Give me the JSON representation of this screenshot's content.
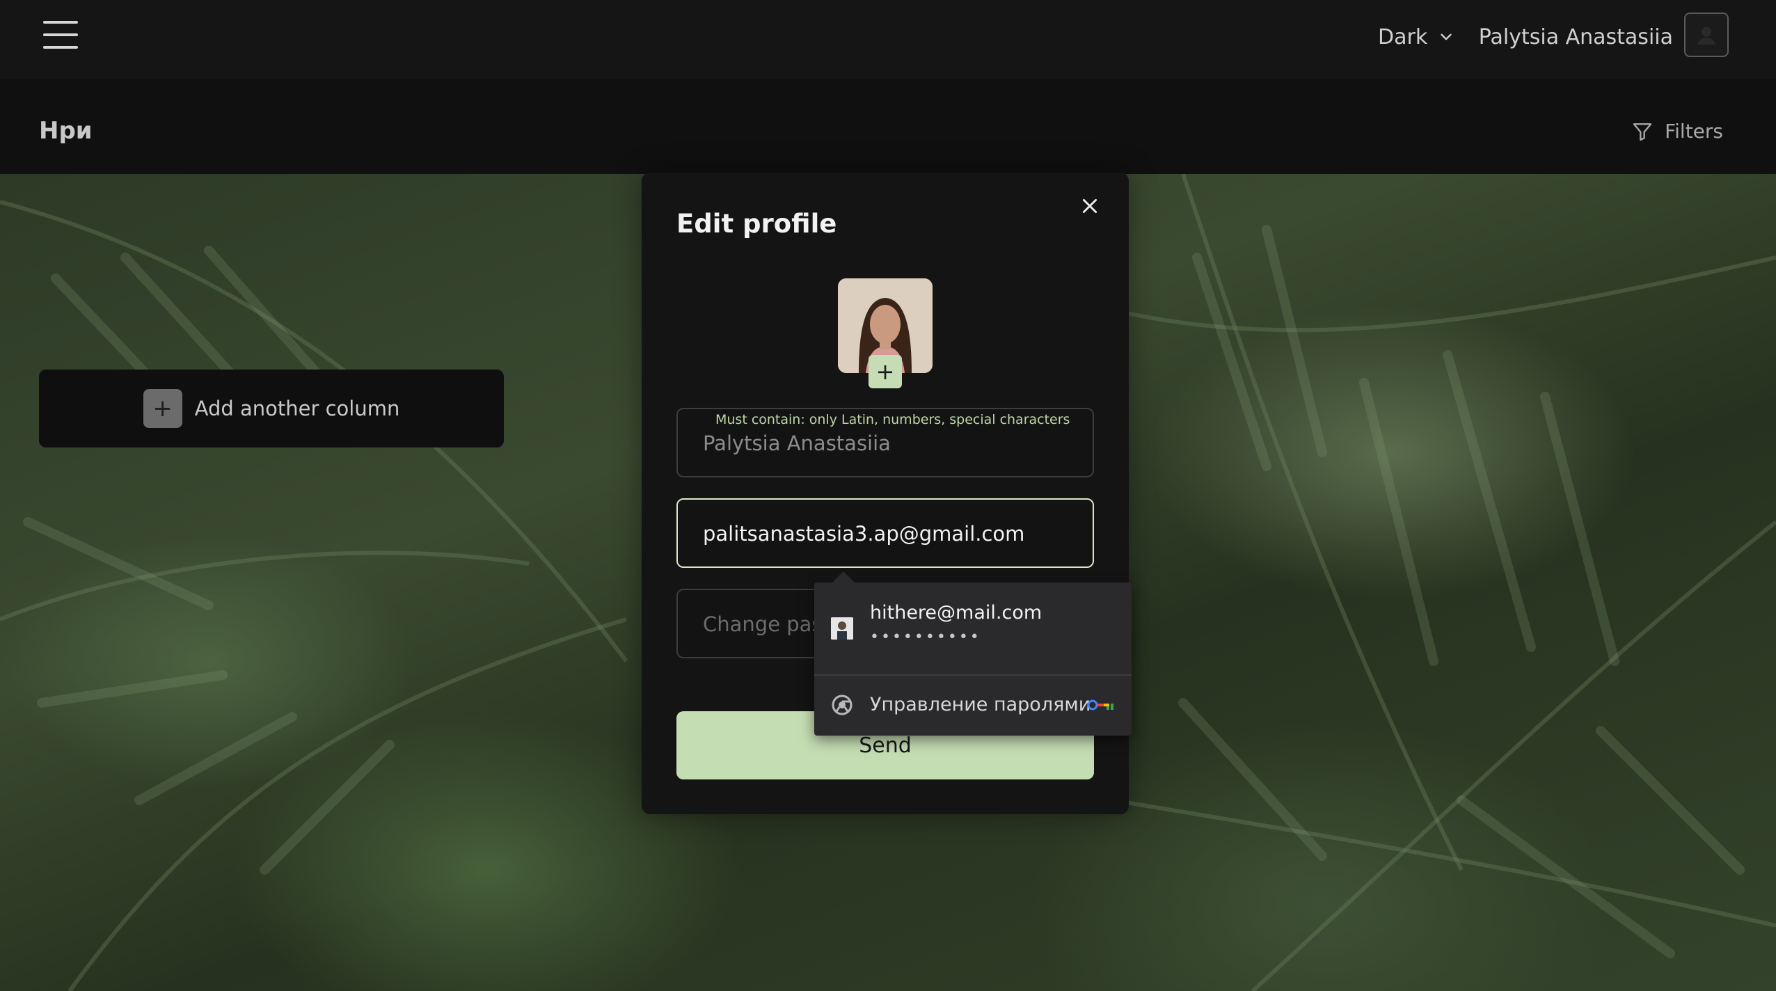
{
  "topbar": {
    "theme": {
      "selected": "Dark",
      "icon": "chevron-down-icon"
    },
    "user_name": "Palytsia Anastasiia"
  },
  "board": {
    "title": "Нри",
    "filters_label": "Filters",
    "add_column_label": "Add another column"
  },
  "modal": {
    "title": "Edit profile",
    "name_field": {
      "hint": "Must contain: only Latin, numbers, special characters",
      "value": "Palytsia Anastasiia"
    },
    "email_field": {
      "value": "palitsanastasia3.ap@gmail.com"
    },
    "password_field": {
      "placeholder": "Change pas"
    },
    "send_label": "Send"
  },
  "autofill": {
    "account_email": "hithere@mail.com",
    "password_mask": "••••••••••",
    "manage_label": "Управление паролями"
  },
  "colors": {
    "accent": "#c5ddb3",
    "hint_text": "#bcd8a6",
    "modal_bg": "#141414",
    "topbar_bg": "#151515"
  }
}
